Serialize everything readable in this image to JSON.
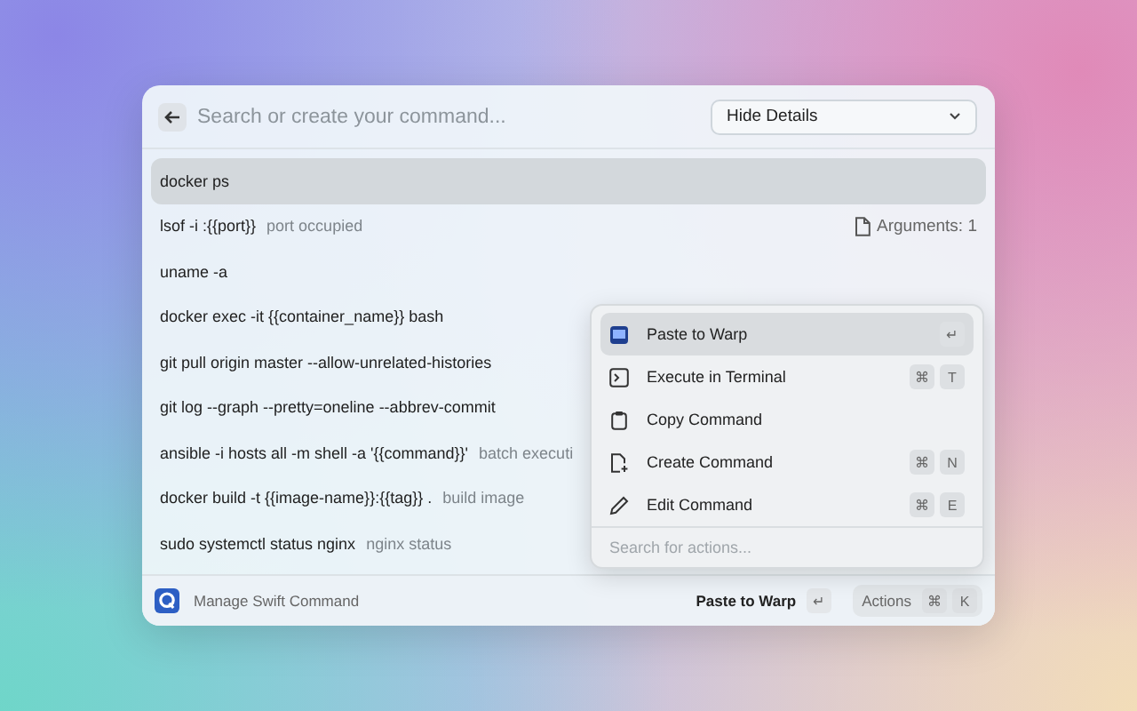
{
  "search": {
    "placeholder": "Search or create your command..."
  },
  "details_select": {
    "value": "Hide Details"
  },
  "commands": [
    {
      "command": "docker ps",
      "selected": true
    },
    {
      "command": "lsof -i :{{port}}",
      "description": "port occupied",
      "arguments": "Arguments: 1",
      "selected": false
    },
    {
      "command": "uname -a",
      "selected": false
    },
    {
      "command": "docker exec -it {{container_name}} bash",
      "selected": false
    },
    {
      "command": "git pull origin master --allow-unrelated-histories",
      "selected": false
    },
    {
      "command": "git log --graph --pretty=oneline --abbrev-commit",
      "selected": false
    },
    {
      "command": "ansible -i hosts all -m shell -a '{{command}}'",
      "description": "batch executi",
      "selected": false
    },
    {
      "command": "docker build -t {{image-name}}:{{tag}} .",
      "description": "build image",
      "selected": false
    },
    {
      "command": "sudo systemctl status nginx",
      "description": "nginx status",
      "selected": false
    }
  ],
  "actions_menu": {
    "items": [
      {
        "label": "Paste to Warp",
        "keys": [
          "↵"
        ],
        "selected": true
      },
      {
        "label": "Execute in Terminal",
        "keys": [
          "⌘",
          "T"
        ],
        "selected": false
      },
      {
        "label": "Copy Command",
        "selected": false
      },
      {
        "label": "Create Command",
        "keys": [
          "⌘",
          "N"
        ],
        "selected": false
      },
      {
        "label": "Edit Command",
        "keys": [
          "⌘",
          "E"
        ],
        "selected": false
      }
    ],
    "placeholder": "Search for actions..."
  },
  "footer": {
    "title": "Manage Swift Command",
    "primary_action": "Paste to Warp",
    "primary_key": "↵",
    "actions_label": "Actions",
    "actions_keys": [
      "⌘",
      "K"
    ]
  }
}
